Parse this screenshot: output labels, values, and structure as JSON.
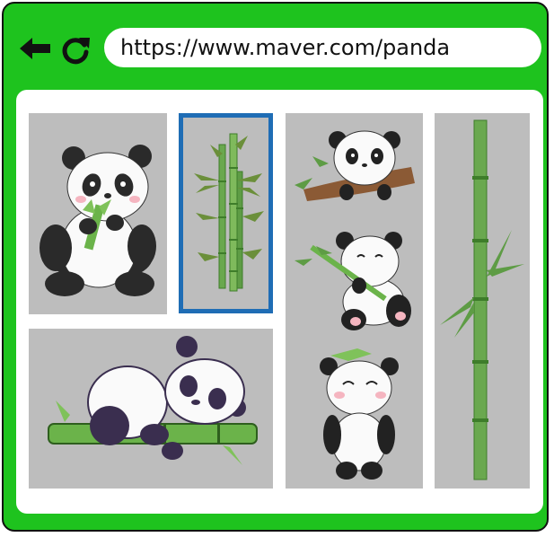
{
  "browser": {
    "url": "https://www.maver.com/panda",
    "colors": {
      "frame": "#1ec31e",
      "tile_bg": "#bdbdbd",
      "selected_border": "#1f6db5"
    },
    "nav_icons": [
      "back-arrow-icon",
      "reload-icon"
    ]
  },
  "gallery": {
    "tiles": [
      {
        "id": "panda-eating-bamboo",
        "selected": false
      },
      {
        "id": "bamboo-bush",
        "selected": true
      },
      {
        "id": "three-pandas",
        "selected": false
      },
      {
        "id": "bamboo-stalk",
        "selected": false
      },
      {
        "id": "sleeping-panda-on-bamboo",
        "selected": false
      }
    ]
  }
}
